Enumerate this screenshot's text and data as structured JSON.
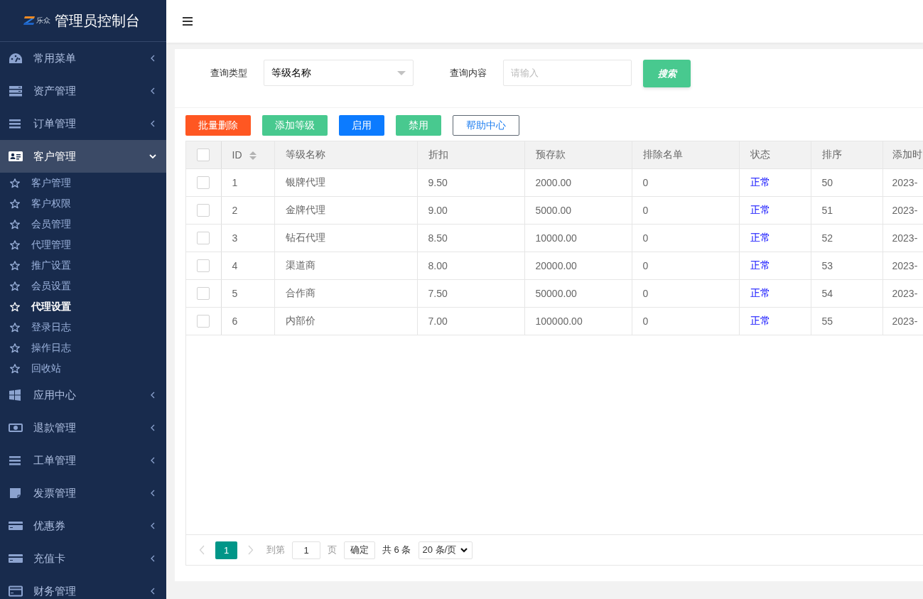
{
  "sidebar": {
    "brand": "乐众",
    "title": "管理员控制台",
    "items": [
      {
        "label": "常用菜单",
        "expanded": false
      },
      {
        "label": "资产管理",
        "expanded": false
      },
      {
        "label": "订单管理",
        "expanded": false
      },
      {
        "label": "客户管理",
        "expanded": true,
        "children": [
          {
            "label": "客户管理",
            "selected": false
          },
          {
            "label": "客户权限",
            "selected": false
          },
          {
            "label": "会员管理",
            "selected": false
          },
          {
            "label": "代理管理",
            "selected": false
          },
          {
            "label": "推广设置",
            "selected": false
          },
          {
            "label": "会员设置",
            "selected": false
          },
          {
            "label": "代理设置",
            "selected": true
          },
          {
            "label": "登录日志",
            "selected": false
          },
          {
            "label": "操作日志",
            "selected": false
          },
          {
            "label": "回收站",
            "selected": false
          }
        ]
      },
      {
        "label": "应用中心",
        "expanded": false
      },
      {
        "label": "退款管理",
        "expanded": false
      },
      {
        "label": "工单管理",
        "expanded": false
      },
      {
        "label": "发票管理",
        "expanded": false
      },
      {
        "label": "优惠券",
        "expanded": false
      },
      {
        "label": "充值卡",
        "expanded": false
      },
      {
        "label": "财务管理",
        "expanded": false
      }
    ]
  },
  "search": {
    "fields": [
      {
        "kind": "select",
        "label": "查询类型",
        "value": "等级名称"
      },
      {
        "kind": "input",
        "label": "查询内容",
        "placeholder": "请输入"
      }
    ],
    "button": "搜索"
  },
  "toolbar": [
    {
      "label": "批量删除",
      "kind": "danger"
    },
    {
      "label": "添加等级",
      "kind": "success"
    },
    {
      "label": "启用",
      "kind": "primary"
    },
    {
      "label": "禁用",
      "kind": "success"
    },
    {
      "label": "帮助中心",
      "kind": "outline"
    }
  ],
  "table": {
    "select_all_checked": false,
    "columns": [
      {
        "label": "ID",
        "kind": "sortable"
      },
      {
        "label": "等级名称",
        "kind": "text"
      },
      {
        "label": "折扣",
        "kind": "text"
      },
      {
        "label": "预存款",
        "kind": "text"
      },
      {
        "label": "排除名单",
        "kind": "text"
      },
      {
        "label": "状态",
        "kind": "status"
      },
      {
        "label": "排序",
        "kind": "text"
      },
      {
        "label": "添加时",
        "kind": "text"
      }
    ],
    "rows": [
      {
        "checked": false,
        "cells": [
          "1",
          "银牌代理",
          "9.50",
          "2000.00",
          "0",
          "正常",
          "50",
          "2023-"
        ]
      },
      {
        "checked": false,
        "cells": [
          "2",
          "金牌代理",
          "9.00",
          "5000.00",
          "0",
          "正常",
          "51",
          "2023-"
        ]
      },
      {
        "checked": false,
        "cells": [
          "3",
          "钻石代理",
          "8.50",
          "10000.00",
          "0",
          "正常",
          "52",
          "2023-"
        ]
      },
      {
        "checked": false,
        "cells": [
          "4",
          "渠道商",
          "8.00",
          "20000.00",
          "0",
          "正常",
          "53",
          "2023-"
        ]
      },
      {
        "checked": false,
        "cells": [
          "5",
          "合作商",
          "7.50",
          "50000.00",
          "0",
          "正常",
          "54",
          "2023-"
        ]
      },
      {
        "checked": false,
        "cells": [
          "6",
          "内部价",
          "7.00",
          "100000.00",
          "0",
          "正常",
          "55",
          "2023-"
        ]
      }
    ]
  },
  "pagination": {
    "prev_disabled": true,
    "next_disabled": true,
    "pages": [
      {
        "label": "1",
        "selected": true
      }
    ],
    "goto_label": "到第",
    "goto_value": "1",
    "goto_unit": "页",
    "confirm": "确定",
    "total": "共 6 条",
    "page_size": "20 条/页"
  }
}
